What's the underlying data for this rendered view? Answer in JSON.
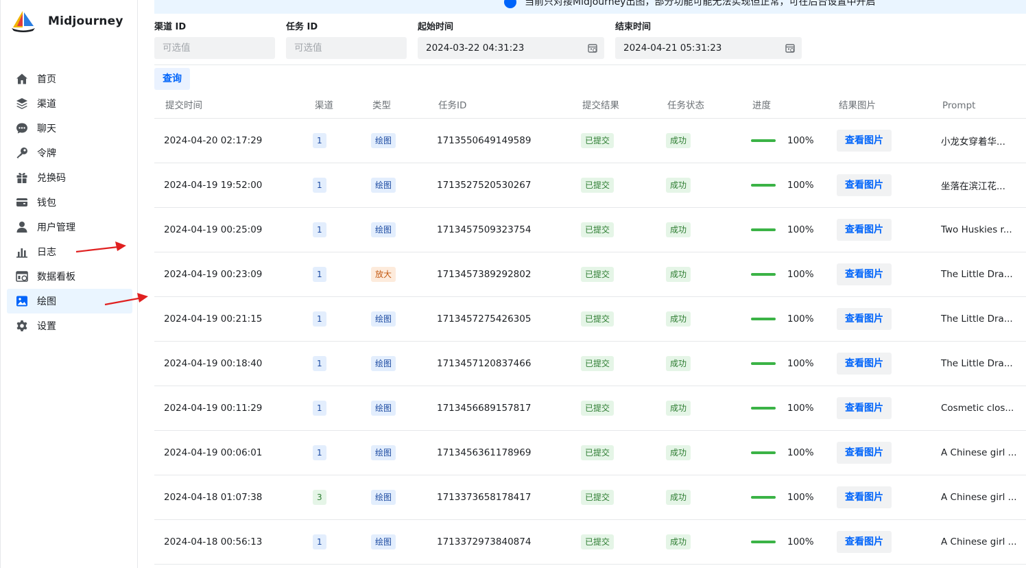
{
  "app": {
    "name": "Midjourney"
  },
  "banner": {
    "text": "当前只对接Midjourney出图，部分功能可能无法实现但正常，可在后台设置中开启"
  },
  "sidebar": {
    "items": [
      {
        "label": "首页",
        "icon": "home-icon"
      },
      {
        "label": "渠道",
        "icon": "layers-icon"
      },
      {
        "label": "聊天",
        "icon": "chat-icon"
      },
      {
        "label": "令牌",
        "icon": "key-icon"
      },
      {
        "label": "兑换码",
        "icon": "gift-icon"
      },
      {
        "label": "钱包",
        "icon": "wallet-icon"
      },
      {
        "label": "用户管理",
        "icon": "user-icon"
      },
      {
        "label": "日志",
        "icon": "bar-chart-icon"
      },
      {
        "label": "数据看板",
        "icon": "dashboard-icon"
      },
      {
        "label": "绘图",
        "icon": "image-icon",
        "active": true
      },
      {
        "label": "设置",
        "icon": "gear-icon"
      }
    ]
  },
  "filters": {
    "channel_id": {
      "label": "渠道 ID",
      "placeholder": "可选值"
    },
    "task_id": {
      "label": "任务 ID",
      "placeholder": "可选值"
    },
    "start_time": {
      "label": "起始时间",
      "value": "2024-03-22 04:31:23"
    },
    "end_time": {
      "label": "结束时间",
      "value": "2024-04-21 05:31:23"
    },
    "query_label": "查询"
  },
  "table": {
    "columns": [
      "提交时间",
      "渠道",
      "类型",
      "任务ID",
      "提交结果",
      "任务状态",
      "进度",
      "结果图片",
      "Prompt"
    ],
    "view_label": "查看图片",
    "rows": [
      {
        "time": "2024-04-20 02:17:29",
        "channel": "1",
        "type": "绘图",
        "task_id": "1713550649149589",
        "submit": "已提交",
        "status": "成功",
        "progress": "100%",
        "prompt": "小龙女穿着华..."
      },
      {
        "time": "2024-04-19 19:52:00",
        "channel": "1",
        "type": "绘图",
        "task_id": "1713527520530267",
        "submit": "已提交",
        "status": "成功",
        "progress": "100%",
        "prompt": "坐落在滨江花..."
      },
      {
        "time": "2024-04-19 00:25:09",
        "channel": "1",
        "type": "绘图",
        "task_id": "1713457509323754",
        "submit": "已提交",
        "status": "成功",
        "progress": "100%",
        "prompt": "Two Huskies r..."
      },
      {
        "time": "2024-04-19 00:23:09",
        "channel": "1",
        "type": "放大",
        "task_id": "1713457389292802",
        "submit": "已提交",
        "status": "成功",
        "progress": "100%",
        "prompt": "The Little Dra..."
      },
      {
        "time": "2024-04-19 00:21:15",
        "channel": "1",
        "type": "绘图",
        "task_id": "1713457275426305",
        "submit": "已提交",
        "status": "成功",
        "progress": "100%",
        "prompt": "The Little Dra..."
      },
      {
        "time": "2024-04-19 00:18:40",
        "channel": "1",
        "type": "绘图",
        "task_id": "1713457120837466",
        "submit": "已提交",
        "status": "成功",
        "progress": "100%",
        "prompt": "The Little Dra..."
      },
      {
        "time": "2024-04-19 00:11:29",
        "channel": "1",
        "type": "绘图",
        "task_id": "1713456689157817",
        "submit": "已提交",
        "status": "成功",
        "progress": "100%",
        "prompt": "Cosmetic clos..."
      },
      {
        "time": "2024-04-19 00:06:01",
        "channel": "1",
        "type": "绘图",
        "task_id": "1713456361178969",
        "submit": "已提交",
        "status": "成功",
        "progress": "100%",
        "prompt": "A Chinese girl ..."
      },
      {
        "time": "2024-04-18 01:07:38",
        "channel": "3",
        "type": "绘图",
        "task_id": "1713373658178417",
        "submit": "已提交",
        "status": "成功",
        "progress": "100%",
        "prompt": "A Chinese girl ..."
      },
      {
        "time": "2024-04-18 00:56:13",
        "channel": "1",
        "type": "绘图",
        "task_id": "1713372973840874",
        "submit": "已提交",
        "status": "成功",
        "progress": "100%",
        "prompt": "A Chinese girl ..."
      }
    ]
  },
  "colors": {
    "accent": "#0064fa",
    "progress": "#3bb346",
    "arrow": "#e02020"
  }
}
